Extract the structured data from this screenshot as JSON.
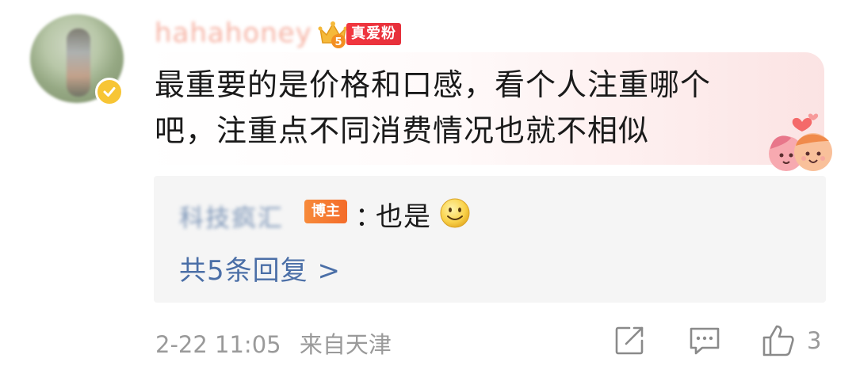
{
  "comment": {
    "username": "hahahoney",
    "level": "5",
    "fan_badge": "真爱粉",
    "text_line1": "最重要的是价格和口感，看个人注重哪个",
    "text_line2": "吧，注重点不同消费情况也就不相似"
  },
  "reply": {
    "author": "科技疯汇",
    "author_badge": "博主",
    "colon": "：",
    "text": "也是",
    "more_label": "共5条回复 >"
  },
  "footer": {
    "date": "2-22 11:05",
    "location": "来自天津",
    "like_count": "3"
  },
  "colors": {
    "link": "#4b6fa7",
    "fan_badge": "#e6303b",
    "author_badge": "#f46c2a",
    "verified": "#f7c535",
    "meta": "#9a9a9a"
  },
  "icons": [
    "verified-icon",
    "crown-level-icon",
    "smile-emoji-icon",
    "love-sticker-icon",
    "share-icon",
    "comment-icon",
    "like-icon"
  ]
}
